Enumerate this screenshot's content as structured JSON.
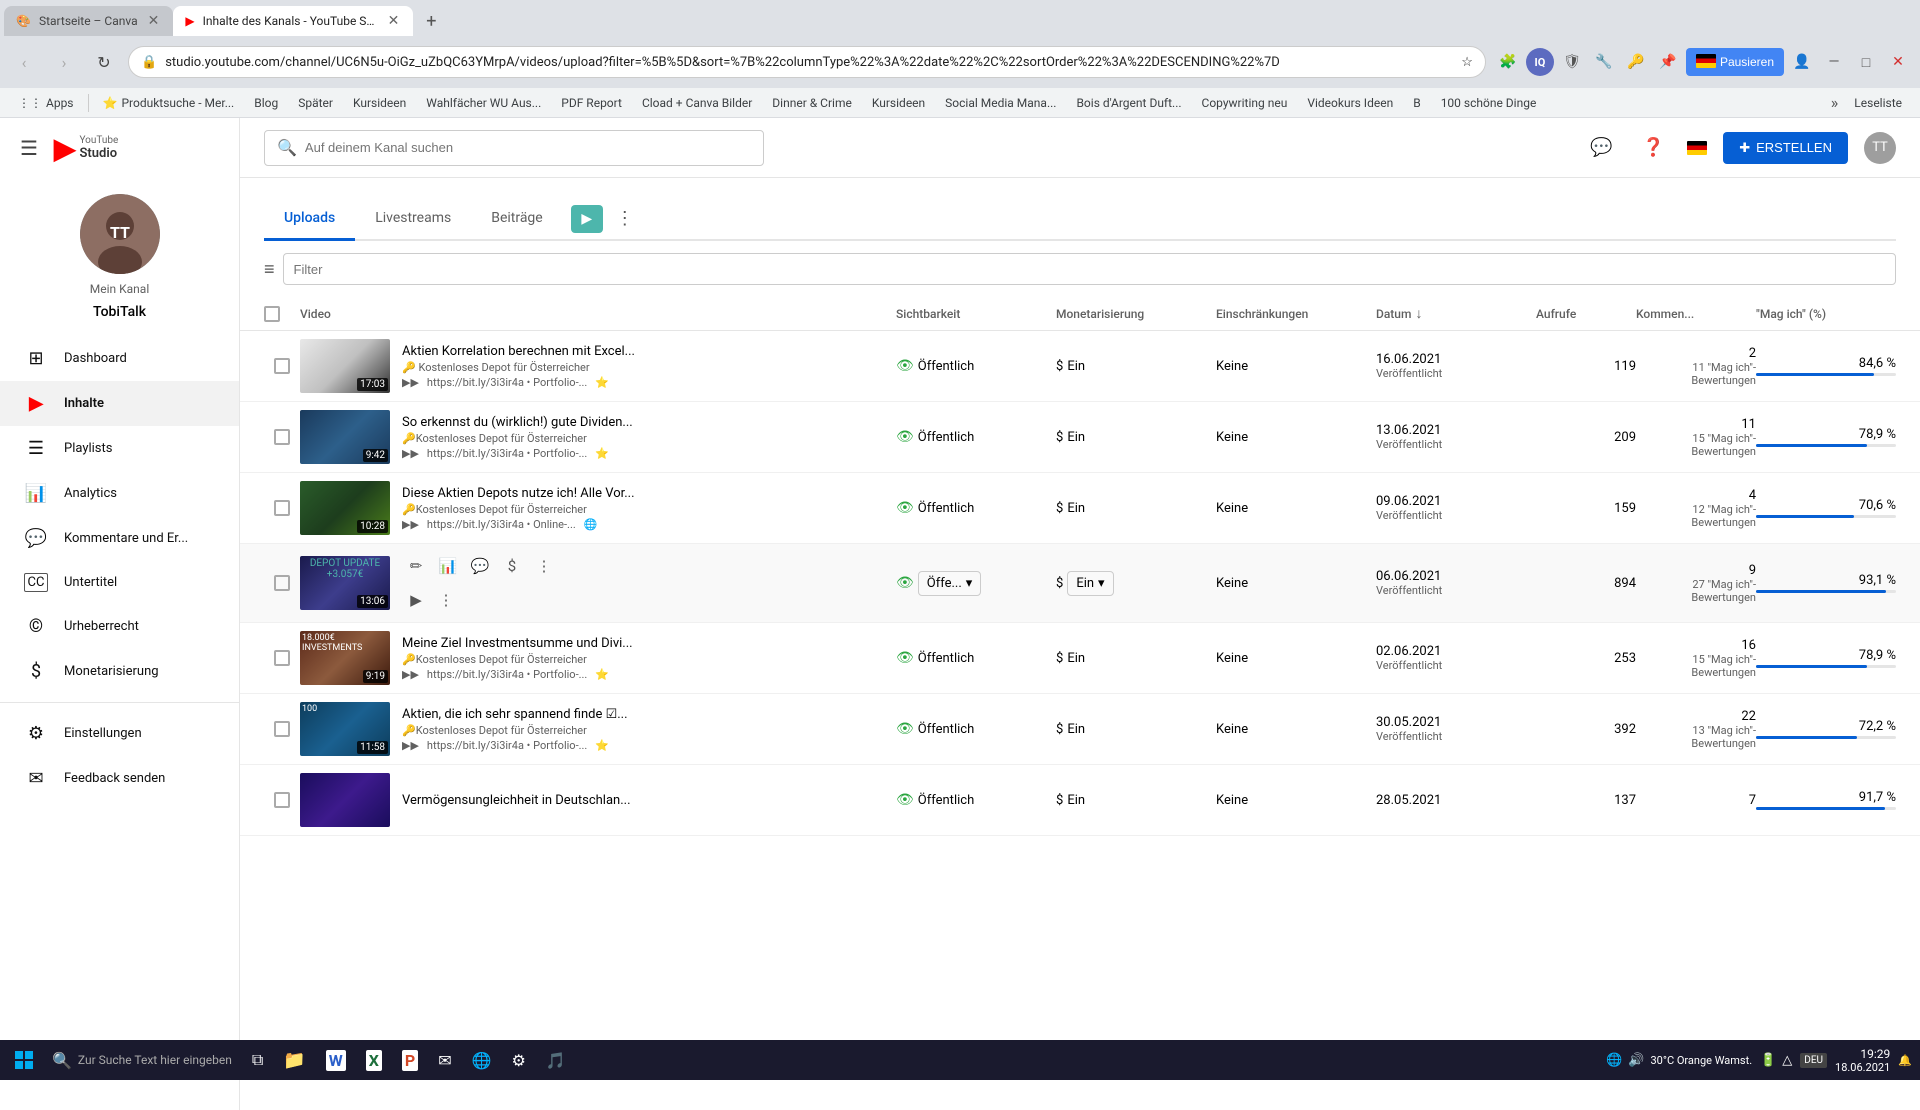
{
  "browser": {
    "tabs": [
      {
        "id": "tab1",
        "title": "Startseite – Canva",
        "active": false,
        "favicon": "🎨"
      },
      {
        "id": "tab2",
        "title": "Inhalte des Kanals - YouTube St...",
        "active": true,
        "favicon": "▶"
      }
    ],
    "url": "studio.youtube.com/channel/UC6N5u-OiGz_uZbQC63YMrpA/videos/upload?filter=%5B%5D&sort=%7B%22columnType%22%3A%22date%22%2C%22sortOrder%22%3A%22DESCENDING%22%7D",
    "bookmarks": [
      {
        "label": "Apps"
      },
      {
        "label": "Produktsuche - Mer..."
      },
      {
        "label": "Blog"
      },
      {
        "label": "Später"
      },
      {
        "label": "Kursideen"
      },
      {
        "label": "Wahlfächer WU Aus..."
      },
      {
        "label": "PDF Report"
      },
      {
        "label": "Cload + Canva Bilder"
      },
      {
        "label": "Dinner & Crime"
      },
      {
        "label": "Kursideen"
      },
      {
        "label": "Social Media Mana..."
      },
      {
        "label": "Bois d'Argent Duft..."
      },
      {
        "label": "Copywriting neu"
      },
      {
        "label": "Videokurs Ideen"
      },
      {
        "label": "B"
      },
      {
        "label": "100 schöne Dinge"
      },
      {
        "label": "Leseliste"
      }
    ],
    "extensions": [
      "IQ",
      "shield",
      "ext1",
      "ext2",
      "ext3"
    ],
    "pausieren_label": "Pausieren"
  },
  "sidebar": {
    "hamburger_label": "☰",
    "logo_text": "Studio",
    "channel": {
      "label": "Mein Kanal",
      "name": "TobiTalk",
      "avatar_text": "TT"
    },
    "nav_items": [
      {
        "id": "dashboard",
        "label": "Dashboard",
        "icon": "⊞"
      },
      {
        "id": "inhalte",
        "label": "Inhalte",
        "icon": "▶",
        "active": true
      },
      {
        "id": "playlists",
        "label": "Playlists",
        "icon": "☰"
      },
      {
        "id": "analytics",
        "label": "Analytics",
        "icon": "📊"
      },
      {
        "id": "kommentare",
        "label": "Kommentare und Er...",
        "icon": "💬"
      },
      {
        "id": "untertitel",
        "label": "Untertitel",
        "icon": "CC"
      },
      {
        "id": "urheberrecht",
        "label": "Urheberrecht",
        "icon": "©"
      },
      {
        "id": "monetarisierung",
        "label": "Monetarisierung",
        "icon": "$"
      },
      {
        "id": "einstellungen",
        "label": "Einstellungen",
        "icon": "⚙"
      },
      {
        "id": "feedback",
        "label": "Feedback senden",
        "icon": "✉"
      }
    ]
  },
  "topbar": {
    "search_placeholder": "Auf deinem Kanal suchen",
    "create_label": "ERSTELLEN",
    "flag": "DE"
  },
  "content": {
    "tabs": [
      {
        "id": "uploads",
        "label": "Uploads",
        "active": true
      },
      {
        "id": "livestreams",
        "label": "Livestreams",
        "active": false
      },
      {
        "id": "beitraege",
        "label": "Beiträge",
        "active": false
      }
    ],
    "filter_placeholder": "Filter",
    "table": {
      "headers": [
        {
          "id": "checkbox",
          "label": ""
        },
        {
          "id": "video",
          "label": "Video"
        },
        {
          "id": "sichtbarkeit",
          "label": "Sichtbarkeit"
        },
        {
          "id": "monetarisierung",
          "label": "Monetarisierung"
        },
        {
          "id": "einschraenkungen",
          "label": "Einschränkungen"
        },
        {
          "id": "datum",
          "label": "Datum",
          "sort": "desc"
        },
        {
          "id": "aufrufe",
          "label": "Aufrufe"
        },
        {
          "id": "kommentare",
          "label": "Kommen..."
        },
        {
          "id": "likes",
          "label": "\"Mag ich\" (%)"
        }
      ],
      "rows": [
        {
          "id": "row1",
          "title": "Aktien Korrelation berechnen mit Excel...",
          "desc1": "Kostenloses Depot für Österreicher",
          "desc2": "https://bit.ly/3i3ir4a • Portfolio-...",
          "duration": "17:03",
          "thumb_class": "thumb-color-1",
          "sichtbarkeit": "Öffentlich",
          "monetarisierung": "Ein",
          "einschraenkungen": "Keine",
          "datum_main": "16.06.2021",
          "datum_sub": "Veröffentlicht",
          "aufrufe": "119",
          "kommentare": "2",
          "likes_pct": "84,6 %",
          "likes_count": "11 \"Mag ich\"-Bewertungen",
          "likes_bar_width": 84,
          "editing": false
        },
        {
          "id": "row2",
          "title": "So erkennst du (wirklich!) gute Dividen...",
          "desc1": "Kostenloses Depot für Österreicher",
          "desc2": "https://bit.ly/3i3ir4a • Portfolio-...",
          "duration": "9:42",
          "thumb_class": "thumb-color-2",
          "sichtbarkeit": "Öffentlich",
          "monetarisierung": "Ein",
          "einschraenkungen": "Keine",
          "datum_main": "13.06.2021",
          "datum_sub": "Veröffentlicht",
          "aufrufe": "209",
          "kommentare": "11",
          "likes_pct": "78,9 %",
          "likes_count": "15 \"Mag ich\"-Bewertungen",
          "likes_bar_width": 79,
          "editing": false
        },
        {
          "id": "row3",
          "title": "Diese Aktien Depots nutze ich! Alle Vor...",
          "desc1": "Kostenloses Depot für Österreicher",
          "desc2": "https://bit.ly/3i3ir4a • Online-...",
          "duration": "10:28",
          "thumb_class": "thumb-color-3",
          "sichtbarkeit": "Öffentlich",
          "monetarisierung": "Ein",
          "einschraenkungen": "Keine",
          "datum_main": "09.06.2021",
          "datum_sub": "Veröffentlicht",
          "aufrufe": "159",
          "kommentare": "4",
          "likes_pct": "70,6 %",
          "likes_count": "12 \"Mag ich\"-Bewertungen",
          "likes_bar_width": 70,
          "editing": false
        },
        {
          "id": "row4",
          "title": "",
          "desc1": "",
          "desc2": "",
          "duration": "13:06",
          "thumb_class": "thumb-color-4",
          "sichtbarkeit": "Öffe...",
          "monetarisierung": "Ein",
          "einschraenkungen": "Keine",
          "datum_main": "06.06.2021",
          "datum_sub": "Veröffentlicht",
          "aufrufe": "894",
          "kommentare": "9",
          "likes_pct": "93,1 %",
          "likes_count": "27 \"Mag ich\"-Bewertungen",
          "likes_bar_width": 93,
          "editing": true
        },
        {
          "id": "row5",
          "title": "Meine Ziel Investmentsumme und Divi...",
          "desc1": "Kostenloses Depot für Österreicher",
          "desc2": "https://bit.ly/3i3ir4a • Portfolio-...",
          "duration": "9:19",
          "thumb_class": "thumb-color-5",
          "sichtbarkeit": "Öffentlich",
          "monetarisierung": "Ein",
          "einschraenkungen": "Keine",
          "datum_main": "02.06.2021",
          "datum_sub": "Veröffentlicht",
          "aufrufe": "253",
          "kommentare": "16",
          "likes_pct": "78,9 %",
          "likes_count": "15 \"Mag ich\"-Bewertungen",
          "likes_bar_width": 79,
          "editing": false
        },
        {
          "id": "row6",
          "title": "Aktien, die ich sehr spannend finde ☑...",
          "desc1": "Kostenloses Depot für Österreicher",
          "desc2": "https://bit.ly/3i3ir4a • Portfolio-...",
          "duration": "11:58",
          "thumb_class": "thumb-color-6",
          "sichtbarkeit": "Öffentlich",
          "monetarisierung": "Ein",
          "einschraenkungen": "Keine",
          "datum_main": "30.05.2021",
          "datum_sub": "Veröffentlicht",
          "aufrufe": "392",
          "kommentare": "22",
          "likes_pct": "72,2 %",
          "likes_count": "13 \"Mag ich\"-Bewertungen",
          "likes_bar_width": 72,
          "editing": false
        },
        {
          "id": "row7",
          "title": "Vermögensungleichheit in Deutschlan...",
          "desc1": "",
          "desc2": "",
          "duration": "",
          "thumb_class": "thumb-color-7",
          "sichtbarkeit": "Öffentlich",
          "monetarisierung": "Ein",
          "einschraenkungen": "Keine",
          "datum_main": "28.05.2021",
          "datum_sub": "",
          "aufrufe": "137",
          "kommentare": "7",
          "likes_pct": "91,7 %",
          "likes_count": "",
          "likes_bar_width": 92,
          "editing": false
        }
      ]
    }
  },
  "taskbar": {
    "time": "19:29",
    "date": "18.06.2021",
    "language": "DEU",
    "temperature": "30°C",
    "weather": "Orange Wamst.",
    "apps": [
      "⊞",
      "🗂",
      "📁",
      "W",
      "X",
      "P",
      "✉",
      "🌐",
      "⚙",
      "🎵"
    ]
  }
}
